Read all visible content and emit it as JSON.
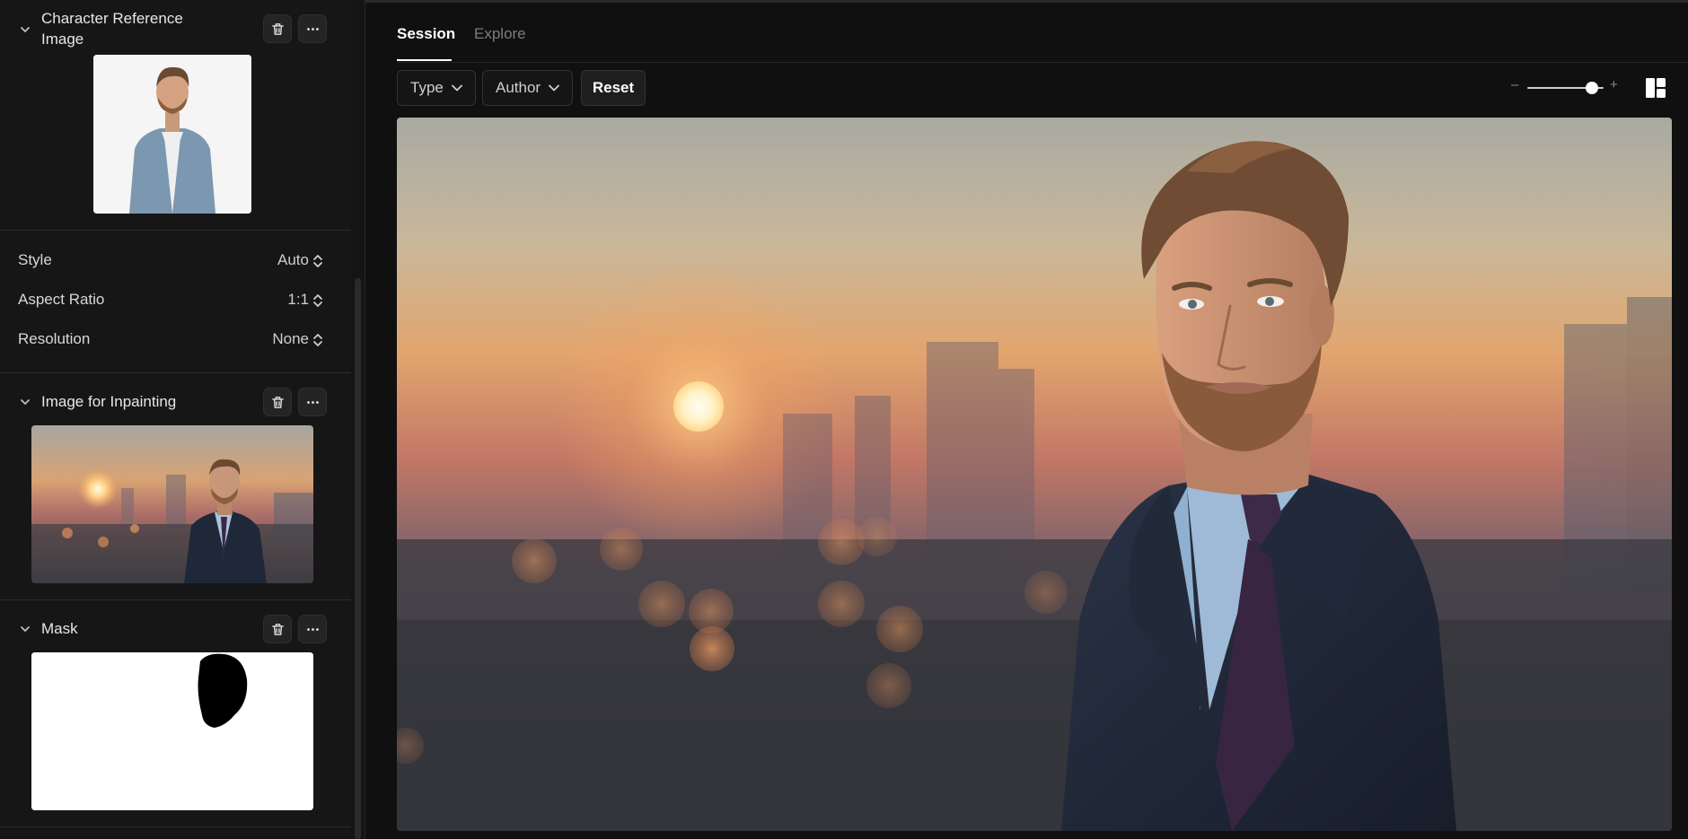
{
  "left_panel": {
    "character_reference": {
      "title_line1": "Character Reference",
      "title_line2": "Image"
    },
    "settings": [
      {
        "label": "Style",
        "value": "Auto"
      },
      {
        "label": "Aspect Ratio",
        "value": "1:1"
      },
      {
        "label": "Resolution",
        "value": "None"
      }
    ],
    "inpainting": {
      "title": "Image for Inpainting"
    },
    "mask": {
      "title": "Mask"
    }
  },
  "main": {
    "tabs": [
      {
        "label": "Session",
        "active": true
      },
      {
        "label": "Explore",
        "active": false
      }
    ],
    "filters": {
      "type_label": "Type",
      "author_label": "Author",
      "reset_label": "Reset"
    },
    "zoom": {
      "minus": "–",
      "plus": "+",
      "level": 0.85
    }
  },
  "icons": {
    "collapse": "chevron-down-icon",
    "delete": "trash-icon",
    "more": "more-horizontal-icon",
    "stepper": "chevron-up-down-icon",
    "layout": "layout-grid-icon"
  },
  "colors": {
    "panel_bg": "#161616",
    "main_bg": "#101010",
    "accent_text": "#ffffff",
    "muted_text": "#7d7d7d"
  }
}
